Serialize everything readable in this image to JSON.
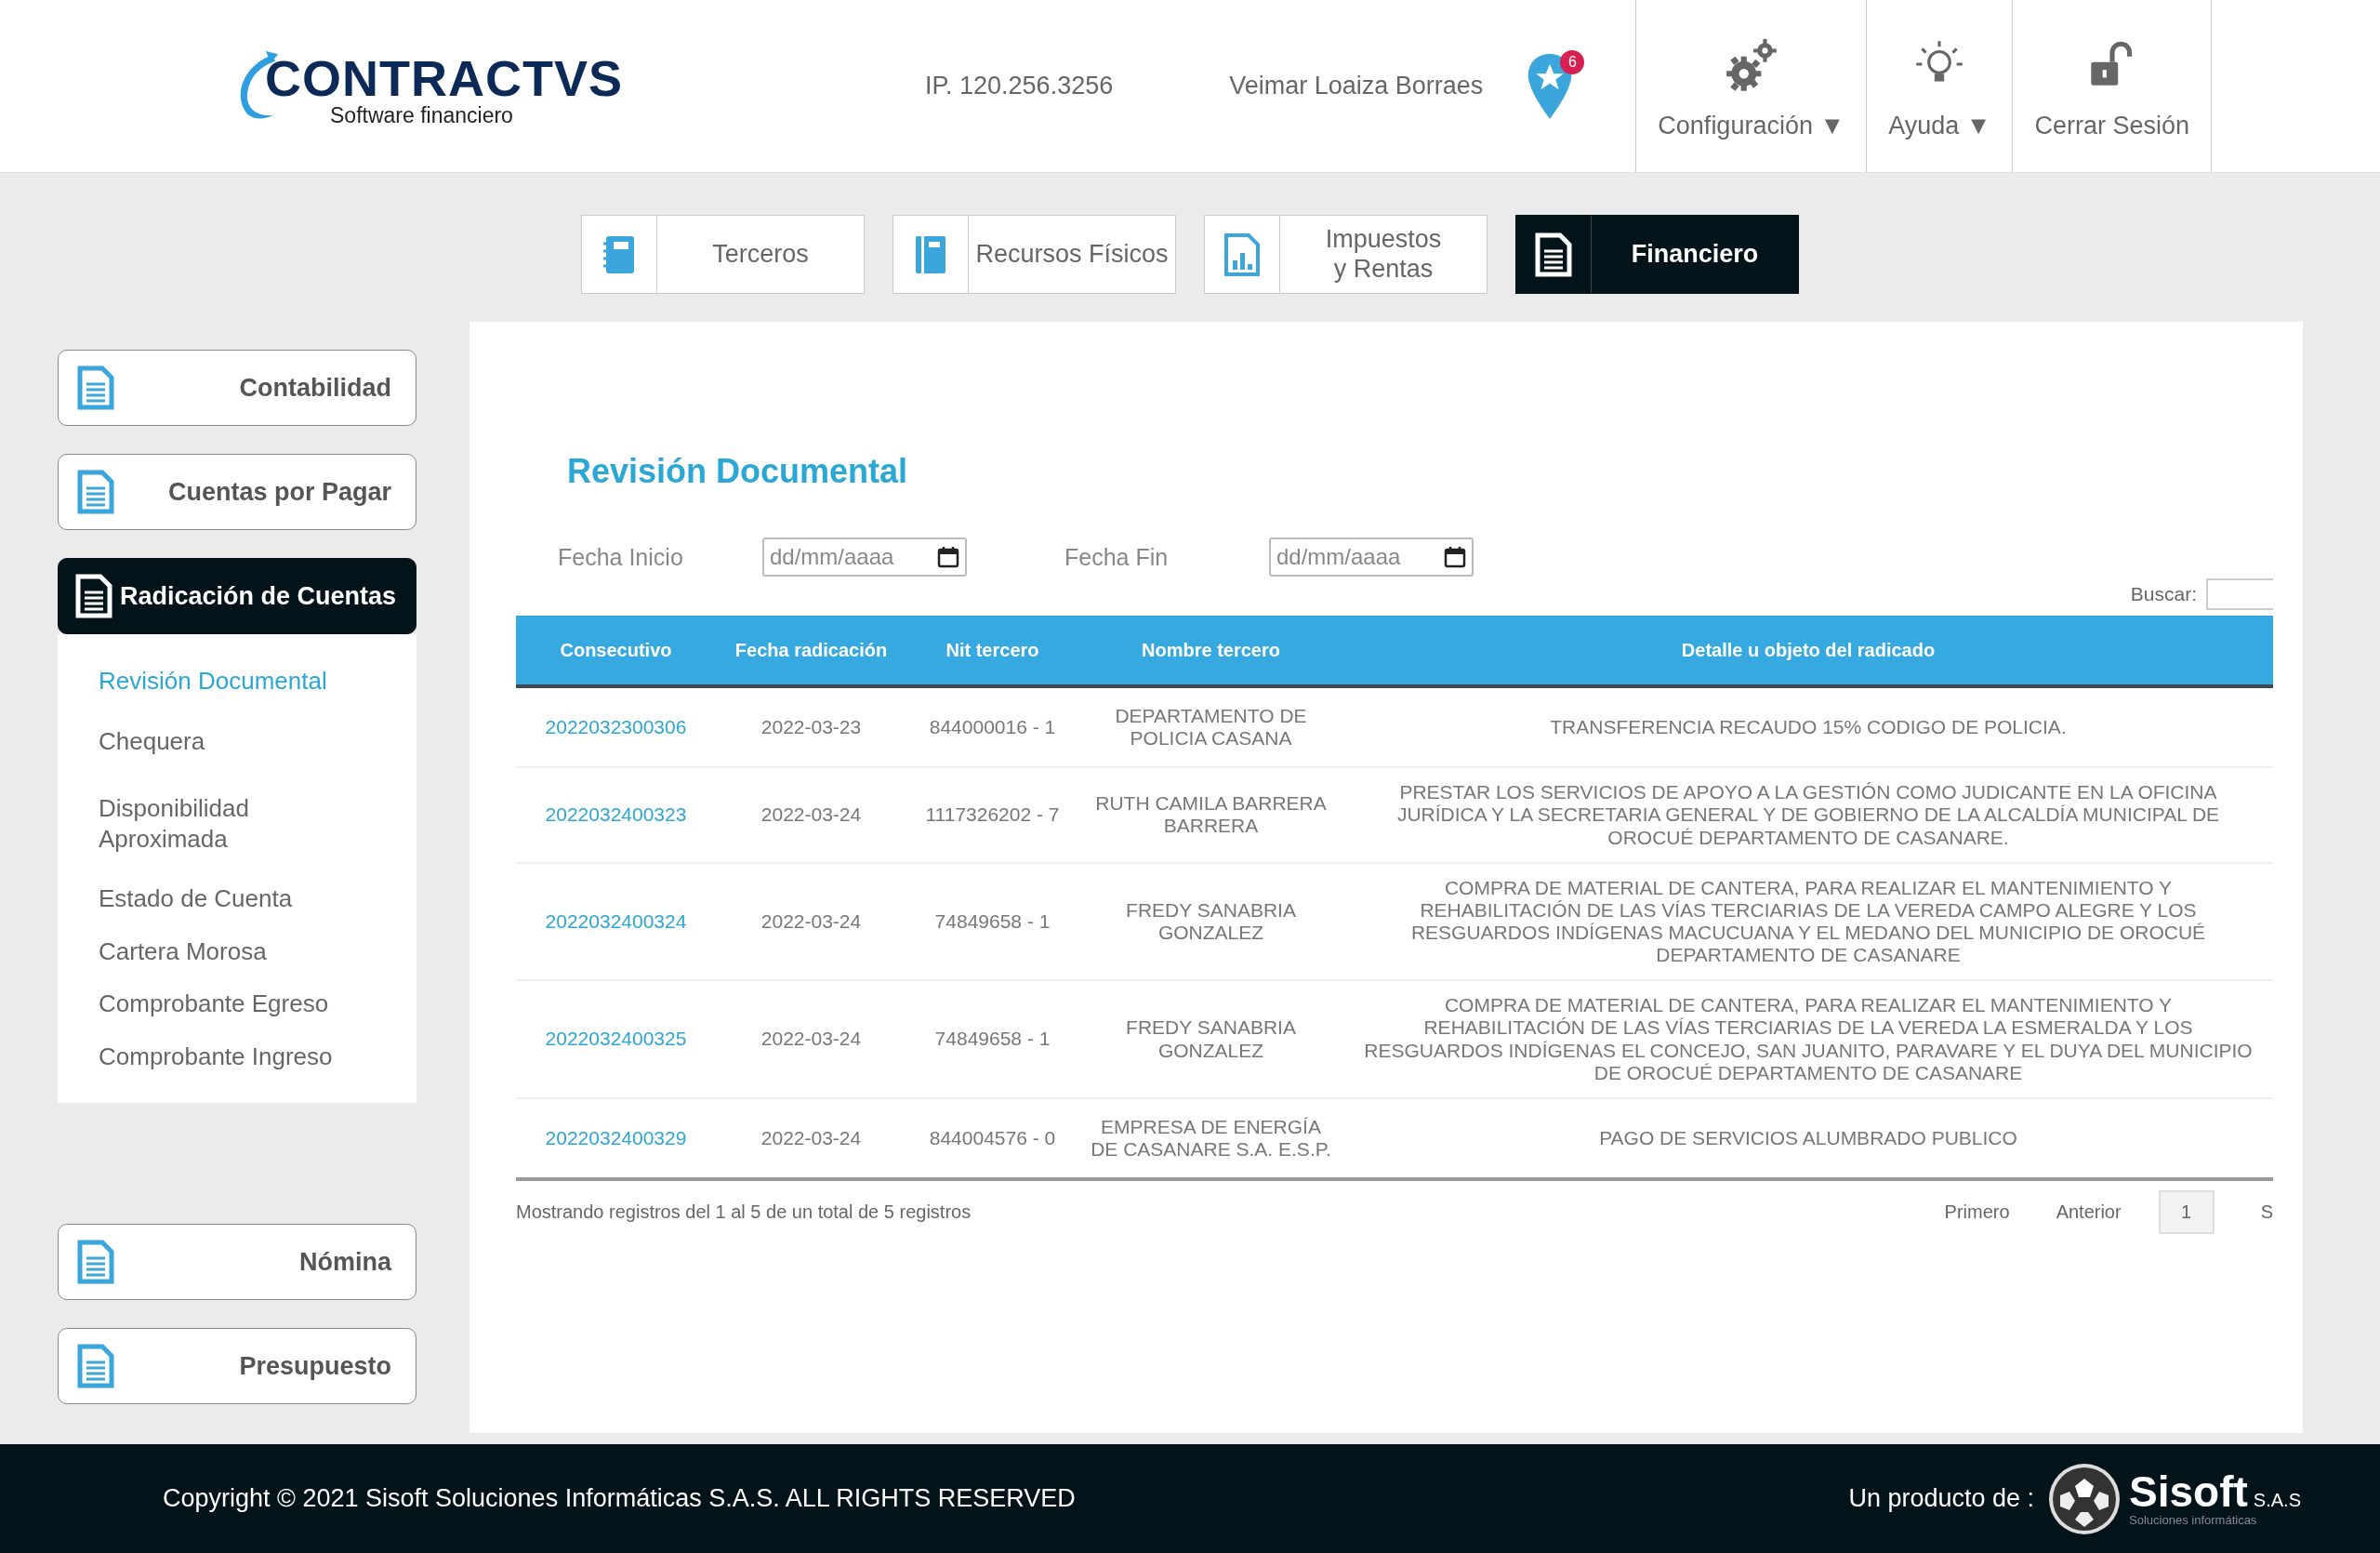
{
  "header": {
    "logo": {
      "name": "CONTRACTVS",
      "tagline": "Software financiero"
    },
    "ip": "IP. 120.256.3256",
    "user": "Veimar Loaiza Borraes",
    "notifications": "6",
    "menu": [
      {
        "kind": "gears",
        "label": "Configuración",
        "caret": "▼"
      },
      {
        "kind": "bulb",
        "label": "Ayuda",
        "caret": "▼"
      },
      {
        "kind": "lock",
        "label": "Cerrar Sesión"
      }
    ]
  },
  "modules": [
    {
      "kind": "book",
      "label": "Terceros",
      "selected": false
    },
    {
      "kind": "notebook",
      "label": "Recursos Físicos",
      "selected": false
    },
    {
      "kind": "chart",
      "label": "Impuestos\ny Rentas",
      "selected": false
    },
    {
      "kind": "document",
      "label": "Financiero",
      "selected": true
    }
  ],
  "sidebar": {
    "items": [
      {
        "label": "Contabilidad",
        "selected": false
      },
      {
        "label": "Cuentas por Pagar",
        "selected": false
      },
      {
        "label": "Radicación de Cuentas",
        "selected": true,
        "children": [
          {
            "label": "Revisión Documental",
            "selected": true
          },
          {
            "label": "Chequera",
            "selected": false
          },
          {
            "label": "Disponibilidad Aproximada",
            "selected": false
          },
          {
            "label": "Estado de Cuenta",
            "selected": false
          },
          {
            "label": "Cartera Morosa",
            "selected": false
          },
          {
            "label": "Comprobante Egreso",
            "selected": false
          },
          {
            "label": "Comprobante Ingreso",
            "selected": false
          }
        ]
      },
      {
        "label": "Nómina",
        "selected": false
      },
      {
        "label": "Presupuesto",
        "selected": false
      }
    ]
  },
  "content": {
    "title": "Revisión Documental",
    "filters": [
      {
        "label": "Fecha Inicio",
        "placeholder": "dd/mm/aaaa"
      },
      {
        "label": "Fecha Fin",
        "placeholder": "dd/mm/aaaa"
      }
    ],
    "search": {
      "label": "Buscar:"
    },
    "table": {
      "columns": [
        "Consecutivo",
        "Fecha radicación",
        "Nit tercero",
        "Nombre tercero",
        "Detalle u objeto del radicado"
      ],
      "rows": [
        [
          "2022032300306",
          "2022-03-23",
          "844000016 - 1",
          "DEPARTAMENTO DE POLICIA CASANA",
          "TRANSFERENCIA RECAUDO 15% CODIGO DE POLICIA."
        ],
        [
          "2022032400323",
          "2022-03-24",
          "1117326202 - 7",
          "RUTH CAMILA BARRERA BARRERA",
          "PRESTAR LOS SERVICIOS DE APOYO A LA GESTIÓN COMO JUDICANTE EN LA OFICINA JURÍDICA Y LA SECRETARIA GENERAL Y DE GOBIERNO DE LA ALCALDÍA MUNICIPAL DE OROCUÉ DEPARTAMENTO DE CASANARE."
        ],
        [
          "2022032400324",
          "2022-03-24",
          "74849658 - 1",
          "FREDY SANABRIA GONZALEZ",
          "COMPRA DE MATERIAL DE CANTERA, PARA REALIZAR EL MANTENIMIENTO Y REHABILITACIÓN DE LAS VÍAS TERCIARIAS DE LA VEREDA CAMPO ALEGRE Y LOS RESGUARDOS INDÍGENAS MACUCUANA Y EL MEDANO DEL MUNICIPIO DE OROCUÉ DEPARTAMENTO DE CASANARE"
        ],
        [
          "2022032400325",
          "2022-03-24",
          "74849658 - 1",
          "FREDY SANABRIA GONZALEZ",
          "COMPRA DE MATERIAL DE CANTERA, PARA REALIZAR EL MANTENIMIENTO Y REHABILITACIÓN DE LAS VÍAS TERCIARIAS DE LA VEREDA LA ESMERALDA Y LOS RESGUARDOS INDÍGENAS EL CONCEJO, SAN JUANITO, PARAVARE Y EL DUYA DEL MUNICIPIO DE OROCUÉ DEPARTAMENTO DE CASANARE"
        ],
        [
          "2022032400329",
          "2022-03-24",
          "844004576 - 0",
          "EMPRESA DE ENERGÍA DE CASANARE S.A. E.S.P.",
          "PAGO DE SERVICIOS ALUMBRADO PUBLICO"
        ]
      ]
    },
    "info": "Mostrando registros del 1 al 5 de un total de 5 registros",
    "pagination": [
      {
        "label": "Primero",
        "selected": false
      },
      {
        "label": "Anterior",
        "selected": false
      },
      {
        "label": "1",
        "selected": true
      },
      {
        "label": "S",
        "selected": false
      }
    ]
  },
  "footer": {
    "copyright": "Copyright © 2021 Sisoft Soluciones Informáticas S.A.S. ALL RIGHTS RESERVED",
    "product_label": "Un producto de :",
    "brand": "Sisoft",
    "brand_suffix": "S.A.S",
    "brand_tagline": "Soluciones informáticas"
  }
}
